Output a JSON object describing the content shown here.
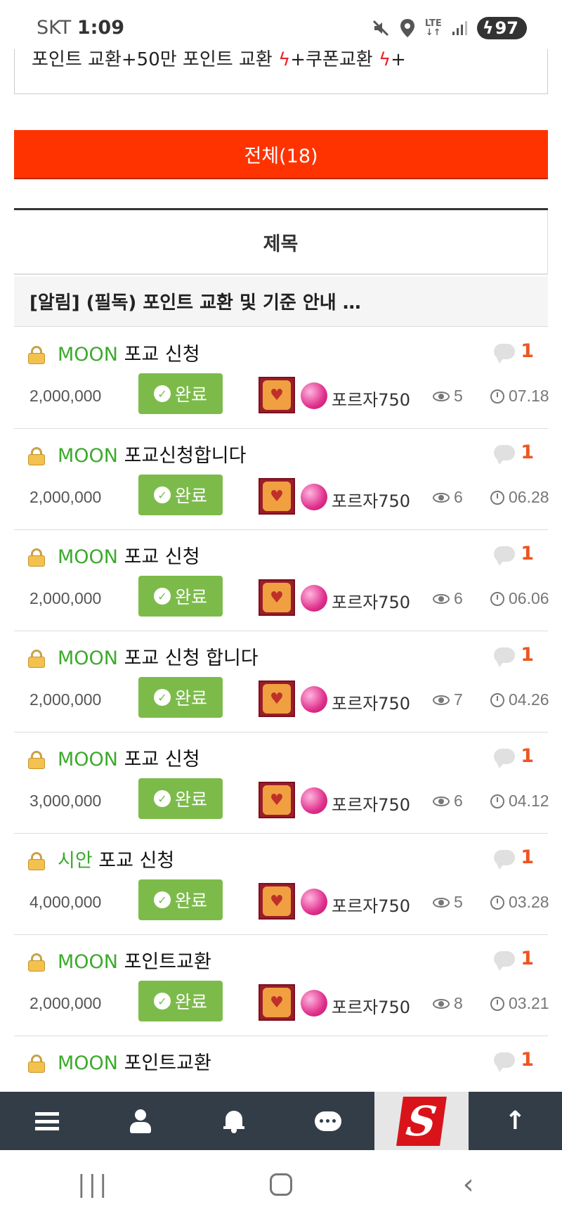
{
  "status_bar": {
    "carrier": "SKT",
    "time": "1:09",
    "network_top": "LTE",
    "network_bottom": "↓↑",
    "battery": "97"
  },
  "notice_box": {
    "text_before": "포인트 교환+50만 포인트 교환 ",
    "text_mid": "+쿠폰교환 ",
    "text_end": "+",
    "bolt": "ϟ"
  },
  "filter_button": {
    "label": "전체(18)"
  },
  "table_header": {
    "title": "제목"
  },
  "pinned_notice": {
    "text": "[알림] (필독) 포인트 교환 및 기준 안내 …"
  },
  "posts": [
    {
      "name": "MOON",
      "title": "포교 신청",
      "comments": "1",
      "amount": "2,000,000",
      "status": "완료",
      "author": "포르자750",
      "views": "5",
      "date": "07.18"
    },
    {
      "name": "MOON",
      "title": "포교신청합니다",
      "comments": "1",
      "amount": "2,000,000",
      "status": "완료",
      "author": "포르자750",
      "views": "6",
      "date": "06.28"
    },
    {
      "name": "MOON",
      "title": "포교 신청",
      "comments": "1",
      "amount": "2,000,000",
      "status": "완료",
      "author": "포르자750",
      "views": "6",
      "date": "06.06"
    },
    {
      "name": "MOON",
      "title": "포교 신청 합니다",
      "comments": "1",
      "amount": "2,000,000",
      "status": "완료",
      "author": "포르자750",
      "views": "7",
      "date": "04.26"
    },
    {
      "name": "MOON",
      "title": "포교 신청",
      "comments": "1",
      "amount": "3,000,000",
      "status": "완료",
      "author": "포르자750",
      "views": "6",
      "date": "04.12"
    },
    {
      "name": "시안",
      "title": "포교 신청",
      "comments": "1",
      "amount": "4,000,000",
      "status": "완료",
      "author": "포르자750",
      "views": "5",
      "date": "03.28"
    },
    {
      "name": "MOON",
      "title": "포인트교환",
      "comments": "1",
      "amount": "2,000,000",
      "status": "완료",
      "author": "포르자750",
      "views": "8",
      "date": "03.21"
    },
    {
      "name": "MOON",
      "title": "포인트교환",
      "comments": "1",
      "amount": "",
      "status": "",
      "author": "",
      "views": "",
      "date": ""
    }
  ],
  "bottom_bar": {
    "logo_letter": "S"
  },
  "colors": {
    "accent_red": "#ff3300",
    "status_green": "#7cbb4a",
    "name_green": "#3caa2c",
    "comment_orange": "#ee5522",
    "bottom_bar": "#333d48"
  },
  "icons": [
    "lock-icon",
    "comment-icon",
    "check-icon",
    "eye-icon",
    "clock-icon",
    "menu-icon",
    "user-icon",
    "bell-icon",
    "chat-icon",
    "arrow-up-icon"
  ]
}
